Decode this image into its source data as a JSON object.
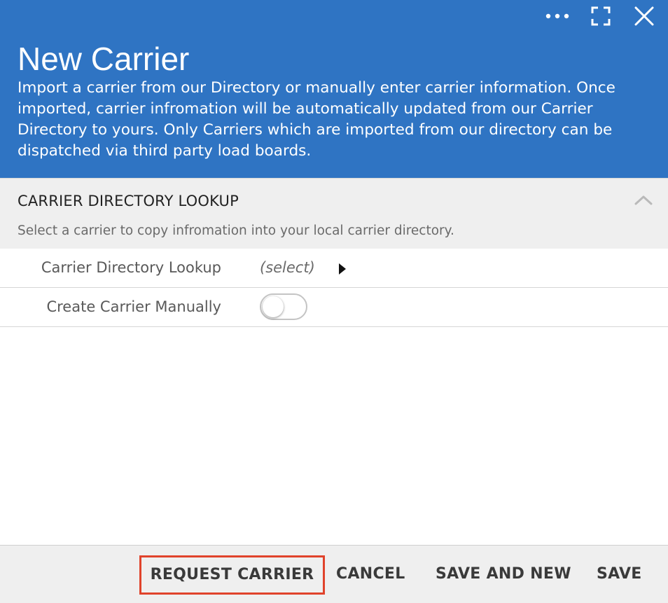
{
  "header": {
    "title": "New Carrier",
    "description": "Import a carrier from our Directory or manually enter carrier information. Once imported, carrier infromation will be automatically updated from our Carrier Directory to yours. Only Carriers which are imported from our directory can be dispatched via third party load boards.",
    "icons": [
      "more-icon",
      "fullscreen-icon",
      "close-icon"
    ],
    "bg_color": "#2f74c3"
  },
  "section": {
    "title": "CARRIER DIRECTORY LOOKUP",
    "subtitle": "Select a carrier to copy infromation into your local carrier directory.",
    "collapse_icon": "chevron-up-icon"
  },
  "form": {
    "lookup_label": "Carrier Directory Lookup",
    "lookup_value": "(select)",
    "manual_label": "Create Carrier Manually",
    "manual_enabled": false
  },
  "footer": {
    "request_label": "REQUEST CARRIER",
    "cancel_label": "CANCEL",
    "save_and_new_label": "SAVE AND NEW",
    "save_label": "SAVE",
    "highlight_color": "#e0432b"
  }
}
